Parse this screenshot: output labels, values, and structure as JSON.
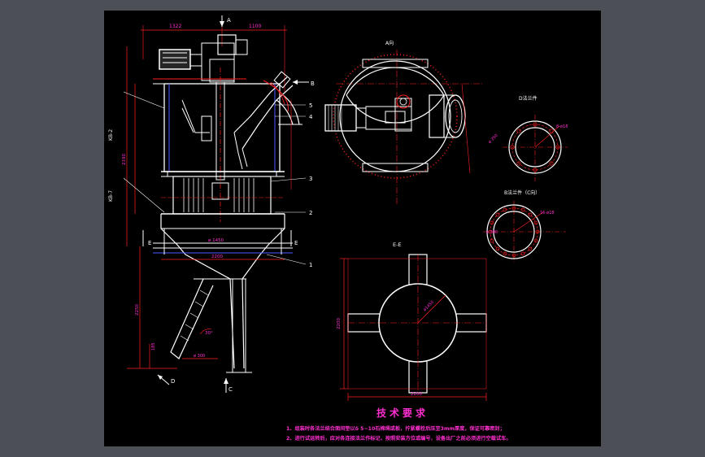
{
  "colors": {
    "frame": "#4d4f57",
    "canvas": "#000000",
    "line": "#ffffff",
    "red": "#ff2020",
    "magenta": "#ff2fd0",
    "blue": "#4a5bff",
    "cyan": "#00e5ff",
    "green": "#22cc33"
  },
  "section_titles": {
    "view_a": "A向",
    "flange_d": "D法兰件",
    "flange_b": "B法兰件（C向）",
    "section_ee": "E-E"
  },
  "main_view": {
    "arrow_a": "A",
    "arrow_b": "B",
    "arrow_c": "C",
    "arrow_d": "D",
    "section_e_left": "E",
    "section_e_right": "E",
    "dims_top": [
      "1322",
      "1100"
    ],
    "dim_inlet": "ø 1450",
    "dim_base": "2200",
    "dim_left_a": "KB-2",
    "dim_left_b": "KB-7",
    "dim_height": "2190",
    "dim_lower": "2250",
    "dim_small": "185",
    "dim_outlet": "ø 300",
    "angle": "30°",
    "part_labels": [
      "5",
      "4",
      "3",
      "2",
      "1"
    ]
  },
  "flange_d_dims": [
    "8-ø18",
    "ø 350"
  ],
  "flange_b_dims": [
    "16-ø18",
    "ø 380"
  ],
  "section_dims": {
    "diameter": "ø1450",
    "width": "2200",
    "height": "2200"
  },
  "requirements": {
    "title": "技术要求",
    "line1": "1、组装时各法兰结合面间垫以δ 5~10石棉绳或板，拧紧螺栓后压至3mm厚度，保证可靠密封；",
    "line2": "2、进行试运转后，应对各连接法兰作标记，按照安装方位或编号，设备出厂之前必须进行空载试车。"
  }
}
